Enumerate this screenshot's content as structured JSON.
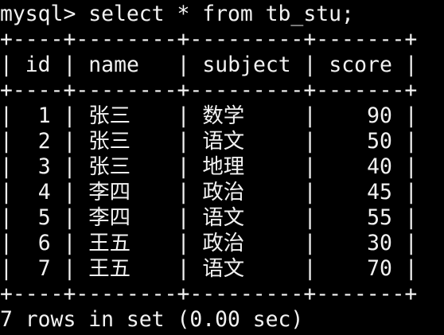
{
  "terminal": {
    "prompt": "mysql> select * from tb_stu;",
    "footer": "7 rows in set (0.00 sec)",
    "background": "#000000",
    "foreground": "#f2f2f2"
  },
  "table": {
    "border": "+----+--------+---------+-------+",
    "col_sep": "|",
    "columns": [
      "id",
      "name",
      "subject",
      "score"
    ],
    "rows": [
      [
        "1",
        "张三",
        "数学",
        "90"
      ],
      [
        "2",
        "张三",
        "语文",
        "50"
      ],
      [
        "3",
        "张三",
        "地理",
        "40"
      ],
      [
        "4",
        "李四",
        "政治",
        "45"
      ],
      [
        "5",
        "李四",
        "语文",
        "55"
      ],
      [
        "6",
        "王五",
        "政治",
        "30"
      ],
      [
        "7",
        "王五",
        "语文",
        "70"
      ]
    ]
  }
}
